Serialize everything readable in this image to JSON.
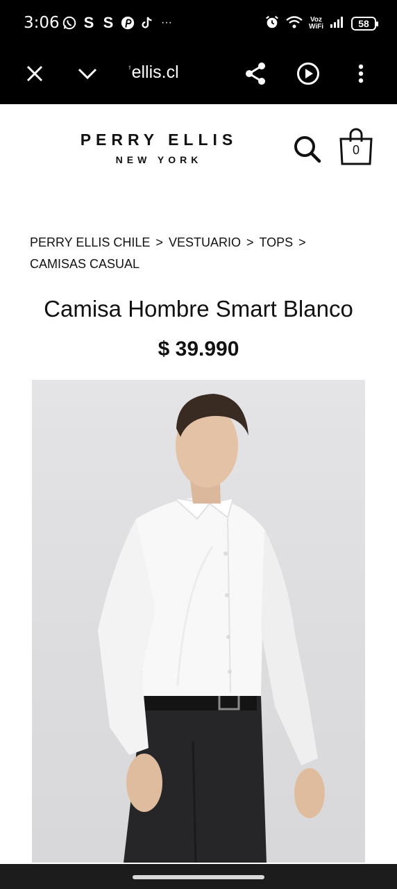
{
  "status_bar": {
    "time": "3:06",
    "notification_icons": [
      "whatsapp-icon",
      "s-app-icon",
      "s-app-icon",
      "pinterest-icon",
      "tiktok-icon"
    ],
    "more": "···",
    "voz_top": "Voz",
    "voz_bottom": "WiFi",
    "battery": "58"
  },
  "browser": {
    "url": "ellis.cl"
  },
  "header": {
    "logo_main": "PERRY ELLIS",
    "logo_sub": "NEW YORK",
    "cart_count": "0"
  },
  "breadcrumb": {
    "items": [
      "PERRY ELLIS CHILE",
      "VESTUARIO",
      "TOPS",
      "CAMISAS CASUAL"
    ],
    "separator": ">"
  },
  "product": {
    "title": "Camisa Hombre Smart Blanco",
    "price": "$ 39.990"
  }
}
